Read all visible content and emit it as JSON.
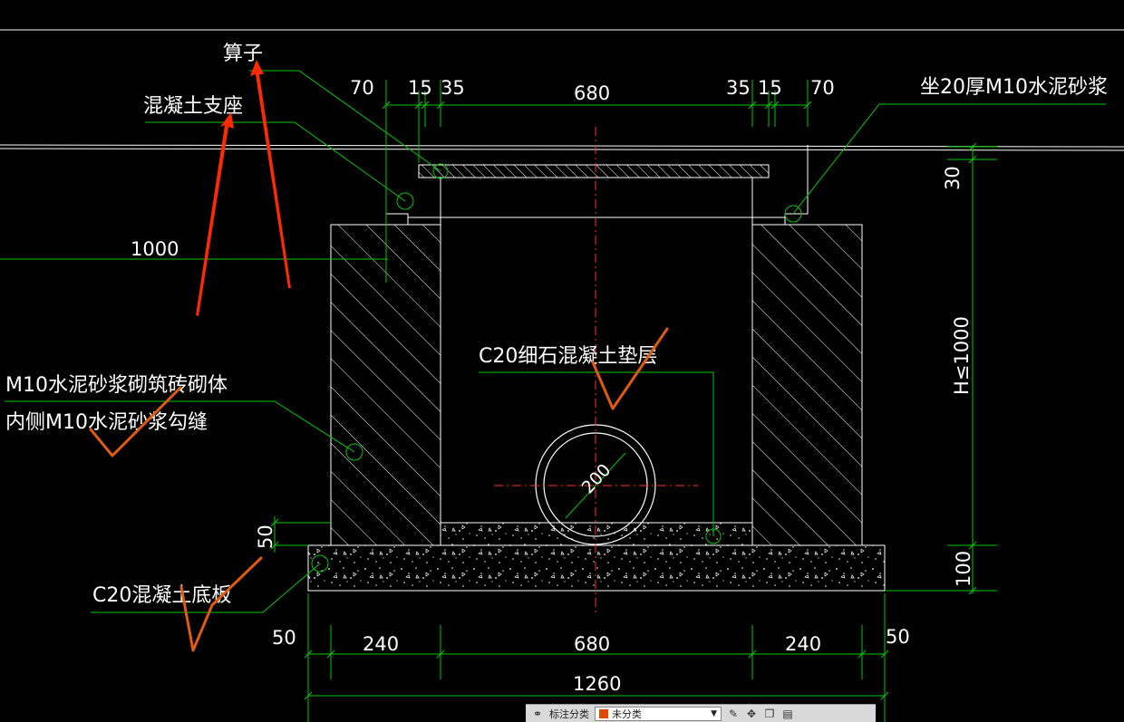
{
  "labels": {
    "grate": "算子",
    "concrete_support": "混凝土支座",
    "mortar_bed": "坐20厚M10水泥砂浆",
    "masonry_line1": "M10水泥砂浆砌筑砖砌体",
    "masonry_line2": "内侧M10水泥砂浆勾缝",
    "fine_concrete_cushion": "C20细石混凝土垫层",
    "base_slab": "C20混凝土底板"
  },
  "dimensions": {
    "top_70_left": "70",
    "top_15_left": "15",
    "top_35_left": "35",
    "top_680": "680",
    "top_35_right": "35",
    "top_15_right": "15",
    "top_70_right": "70",
    "left_1000": "1000",
    "pipe_200": "200",
    "left_50": "50",
    "right_30": "30",
    "right_h": "H≤1000",
    "right_100": "100",
    "bottom_50_left": "50",
    "bottom_240_left": "240",
    "bottom_680": "680",
    "bottom_240_right": "240",
    "bottom_50_right": "50",
    "bottom_1260": "1260"
  },
  "toolbar": {
    "category_label": "标注分类",
    "category_value": "未分类"
  },
  "colors": {
    "background": "#000000",
    "line_white": "#ffffff",
    "dim_green": "#00c800",
    "center_red": "#ff3030",
    "annot_red": "#ff2a00",
    "annot_orange": "#e05a10"
  }
}
